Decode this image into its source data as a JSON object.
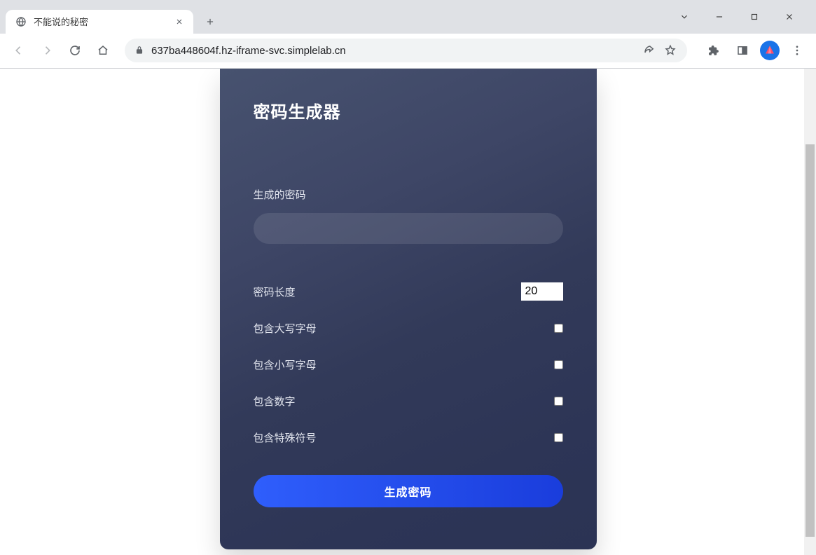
{
  "browser": {
    "tab_title": "不能说的秘密",
    "url": "637ba448604f.hz-iframe-svc.simplelab.cn"
  },
  "card": {
    "title": "密码生成器",
    "result_label": "生成的密码",
    "result_value": "",
    "generate_button": "生成密码",
    "options": {
      "length_label": "密码长度",
      "length_value": "20",
      "uppercase_label": "包含大写字母",
      "lowercase_label": "包含小写字母",
      "numbers_label": "包含数字",
      "symbols_label": "包含特殊符号"
    }
  }
}
